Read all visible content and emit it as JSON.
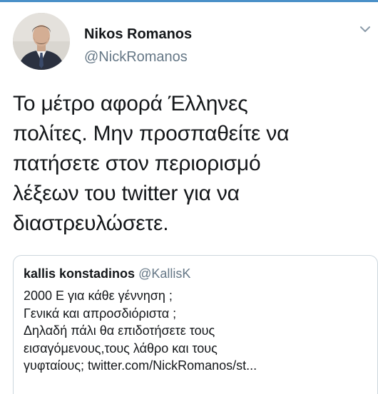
{
  "author": {
    "display_name": "Nikos Romanos",
    "handle": "@NickRomanos"
  },
  "tweet": {
    "lines": [
      "Το μέτρο αφορά Έλληνες",
      "πολίτες. Μην προσπαθείτε να",
      "πατήσετε στον περιορισμό",
      "λέξεων του twitter για να",
      "διαστρευλώσετε."
    ]
  },
  "quoted_tweet": {
    "display_name": "kallis konstadinos",
    "handle": "@KallisK",
    "lines": [
      "2000 Ε για κάθε γέννηση ;",
      "Γενικά και απροσδιόριστα ;",
      "Δηλαδή πάλι θα επιδοτήσετε τους",
      "εισαγόμενους,τους λάθρο και τους",
      "γυφταίους; twitter.com/NickRomanos/st..."
    ]
  },
  "icons": {
    "menu": "chevron-down-icon"
  }
}
